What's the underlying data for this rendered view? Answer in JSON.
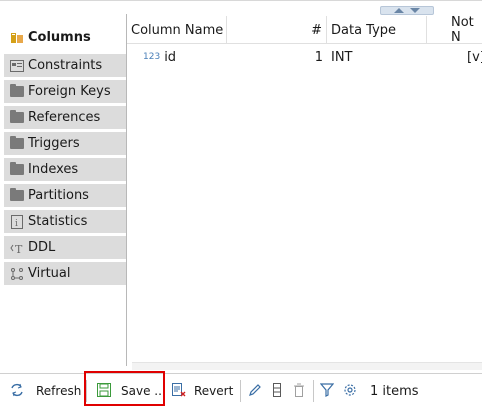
{
  "sidebar": {
    "items": [
      {
        "label": "Columns",
        "icon": "columns-icon",
        "active": true
      },
      {
        "label": "Constraints",
        "icon": "constraints-icon",
        "active": false
      },
      {
        "label": "Foreign Keys",
        "icon": "folder-icon",
        "active": false
      },
      {
        "label": "References",
        "icon": "folder-icon",
        "active": false
      },
      {
        "label": "Triggers",
        "icon": "folder-icon",
        "active": false
      },
      {
        "label": "Indexes",
        "icon": "folder-icon",
        "active": false
      },
      {
        "label": "Partitions",
        "icon": "folder-icon",
        "active": false
      },
      {
        "label": "Statistics",
        "icon": "statistics-icon",
        "active": false
      },
      {
        "label": "DDL",
        "icon": "ddl-icon",
        "active": false
      },
      {
        "label": "Virtual",
        "icon": "virtual-icon",
        "active": false
      }
    ]
  },
  "grid": {
    "columns": [
      "Column Name",
      "#",
      "Data Type",
      "Not N"
    ],
    "rows": [
      {
        "type_badge": "123",
        "name": "id",
        "num": "1",
        "data_type": "INT",
        "not_null": "[v]"
      }
    ]
  },
  "toolbar": {
    "refresh_label": "Refresh",
    "save_label": "Save ...",
    "revert_label": "Revert",
    "items_count": "1 items"
  },
  "colors": {
    "accent": "#4a7fb8",
    "highlight": "#e00000",
    "sidebar_bg": "#dcdcdc"
  }
}
